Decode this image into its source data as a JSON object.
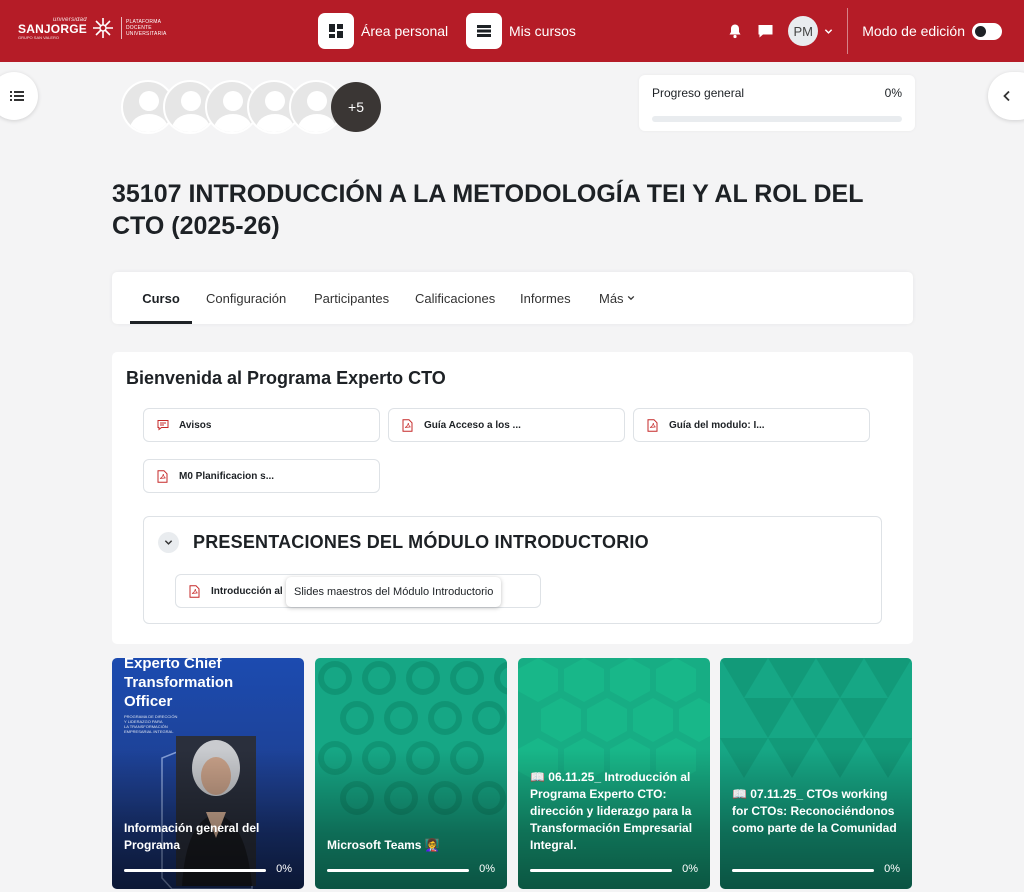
{
  "brand": {
    "uni": "universidad",
    "name": "SANJORGE",
    "group": "GRUPO SAN VALERO",
    "platform": [
      "PLATAFORMA",
      "DOCENTE",
      "UNIVERSITARIA"
    ]
  },
  "navbar": {
    "links": [
      {
        "label": "Área personal",
        "icon": "dashboard-icon"
      },
      {
        "label": "Mis cursos",
        "icon": "courses-icon"
      }
    ],
    "user_initials": "PM",
    "edit_mode_label": "Modo de edición",
    "edit_mode_on": false
  },
  "participants": {
    "more_label": "+5"
  },
  "progress": {
    "label": "Progreso general",
    "percent_label": "0%",
    "value": 0
  },
  "course": {
    "title": "35107 INTRODUCCIÓN A LA METODOLOGÍA TEI Y AL ROL DEL CTO (2025-26)"
  },
  "secondary_nav": {
    "tabs": [
      "Curso",
      "Configuración",
      "Participantes",
      "Calificaciones",
      "Informes",
      "Más"
    ],
    "active": "Curso"
  },
  "section": {
    "title": "Bienvenida al Programa Experto CTO",
    "activities": [
      {
        "label": "Avisos",
        "icon": "forum-icon"
      },
      {
        "label": "Guía Acceso a los ...",
        "icon": "pdf-icon"
      },
      {
        "label": "Guía del modulo: I...",
        "icon": "pdf-icon"
      },
      {
        "label": "M0 Planificacion s...",
        "icon": "pdf-icon"
      }
    ],
    "subsection": {
      "title": "PRESENTACIONES DEL MÓDULO INTRODUCTORIO",
      "activity": "Introducción al Pr...",
      "tooltip": "Slides maestros del Módulo Introductorio"
    }
  },
  "tiles": [
    {
      "name": "Información general del Programa",
      "percent_label": "0%",
      "progress": 0,
      "banner_title": [
        "Experto Chief",
        "Transformation",
        "Officer"
      ],
      "banner_sub": [
        "PROGRAMA DE DIRECCIÓN",
        "Y LIDERAZGO PARA",
        "LA TRANSFORMACIÓN",
        "EMPRESARIAL INTEGRAL"
      ]
    },
    {
      "name": "Microsoft Teams 👩‍🏫",
      "percent_label": "0%",
      "progress": 0
    },
    {
      "name": "📖 06.11.25_ Introducción al Programa Experto CTO: dirección y liderazgo para la Transformación Empresarial Integral.",
      "percent_label": "0%",
      "progress": 0
    },
    {
      "name": "📖 07.11.25_ CTOs working for CTOs: Reconociéndonos como parte de la Comunidad",
      "percent_label": "0%",
      "progress": 0
    }
  ],
  "colors": {
    "brand_red": "#b51c27",
    "tile_blue": "#1c4bb0",
    "tile_teal": "#16a785"
  }
}
